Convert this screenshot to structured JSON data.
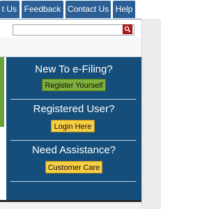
{
  "nav": {
    "tabs": [
      {
        "label": "t Us"
      },
      {
        "label": "Feedback"
      },
      {
        "label": "Contact Us"
      },
      {
        "label": "Help"
      }
    ]
  },
  "search": {
    "placeholder": "",
    "value": ""
  },
  "panel": {
    "sections": [
      {
        "heading": "New To e-Filing?",
        "button": "Register Yourself"
      },
      {
        "heading": "Registered User?",
        "button": "Login Here"
      },
      {
        "heading": "Need Assistance?",
        "button": "Customer Care"
      }
    ]
  },
  "colors": {
    "nav_tab": "#2b5f95",
    "panel": "#154e7a",
    "register_button": "#7fb03d",
    "login_button": "#f7ce44",
    "search_button": "#b51c1c"
  },
  "icons": {
    "search_button": "magnifier-icon"
  }
}
